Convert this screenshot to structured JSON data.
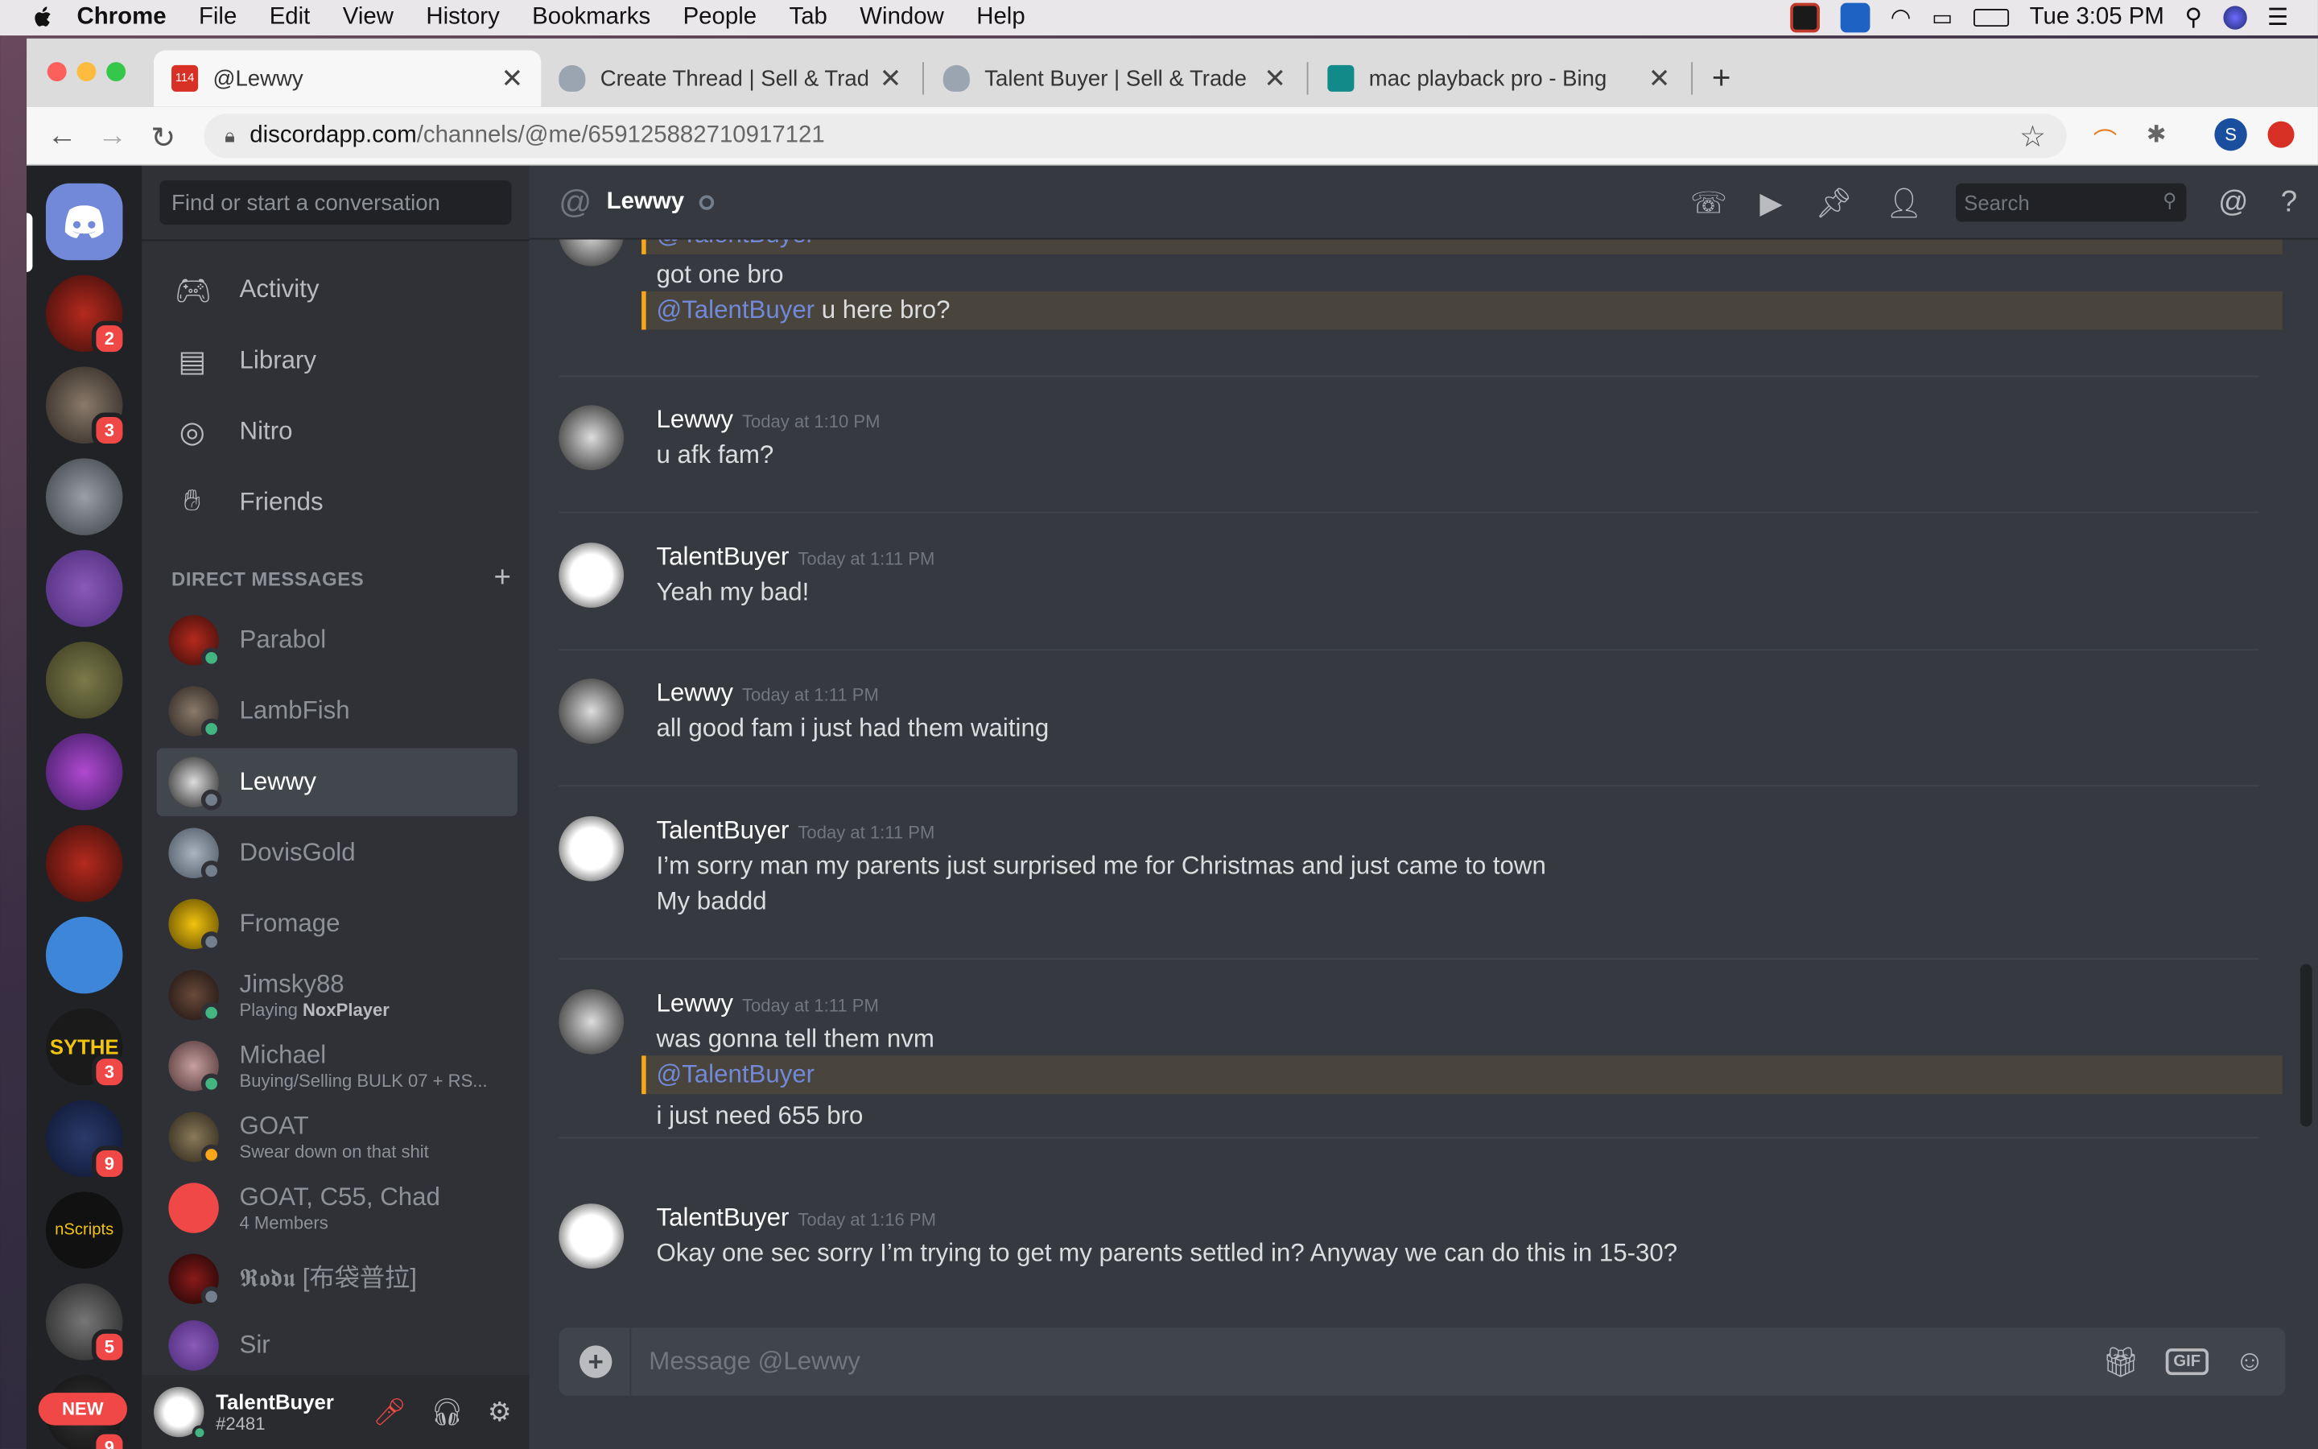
{
  "menubar": {
    "app": "Chrome",
    "items": [
      "File",
      "Edit",
      "View",
      "History",
      "Bookmarks",
      "People",
      "Tab",
      "Window",
      "Help"
    ],
    "clock": "Tue 3:05 PM"
  },
  "browser": {
    "tabs": [
      {
        "title": "@Lewwy",
        "favicon_color": "#d93025",
        "favicon_text": "114"
      },
      {
        "title": "Create Thread | Sell & Trade Ga",
        "favicon_color": "#9aa5b1"
      },
      {
        "title": "Talent Buyer | Sell & Trade Gan",
        "favicon_color": "#9aa5b1"
      },
      {
        "title": "mac playback pro - Bing",
        "favicon_color": "#138a8a"
      }
    ],
    "url_host": "discordapp.com",
    "url_path": "/channels/@me/659125882710917121",
    "profile_letter": "S"
  },
  "discord": {
    "find_placeholder": "Find or start a conversation",
    "nav": [
      "Activity",
      "Library",
      "Nitro",
      "Friends"
    ],
    "dm_header": "DIRECT MESSAGES",
    "guild_badges": [
      "2",
      "3",
      "3",
      "9",
      "9",
      "5"
    ],
    "guild_labels": {
      "sythe": "SYTHE",
      "nscripts": "nScripts",
      "new": "NEW"
    },
    "dms": [
      {
        "name": "Parabol",
        "sub": "",
        "status": "online"
      },
      {
        "name": "LambFish",
        "sub": "",
        "status": "online"
      },
      {
        "name": "Lewwy",
        "sub": "",
        "status": "offline"
      },
      {
        "name": "DovisGold",
        "sub": "",
        "status": "offline"
      },
      {
        "name": "Fromage",
        "sub": "",
        "status": "offline"
      },
      {
        "name": "Jimsky88",
        "sub_prefix": "Playing ",
        "sub_bold": "NoxPlayer",
        "status": "online"
      },
      {
        "name": "Michael",
        "sub": "Buying/Selling BULK 07 + RS...",
        "status": "online"
      },
      {
        "name": "GOAT",
        "sub": "Swear down on that shit",
        "status": "idle"
      },
      {
        "name": "GOAT, C55, Chad",
        "sub": "4 Members",
        "status": ""
      },
      {
        "name": "𝕽𝖔𝖉𝖚 [布袋普拉]",
        "sub": "",
        "status": "offline"
      },
      {
        "name": "Sir",
        "sub": "",
        "status": ""
      }
    ],
    "user": {
      "name": "TalentBuyer",
      "tag": "#2481"
    },
    "channel": {
      "name": "Lewwy",
      "search_placeholder": "Search"
    },
    "messages": {
      "g0": {
        "l1": "@TalentBuyer",
        "l2": "got one bro",
        "l3_mention": "@TalentBuyer",
        "l3_text": " u here bro?"
      },
      "g1": {
        "author": "Lewwy",
        "time": "Today at 1:10 PM",
        "l1": "u afk fam?"
      },
      "g2": {
        "author": "TalentBuyer",
        "time": "Today at 1:11 PM",
        "l1": "Yeah my bad!"
      },
      "g3": {
        "author": "Lewwy",
        "time": "Today at 1:11 PM",
        "l1": "all good fam i just had them waiting"
      },
      "g4": {
        "author": "TalentBuyer",
        "time": "Today at 1:11 PM",
        "l1": "I’m sorry man my parents just surprised me for Christmas and just came to town",
        "l2": "My baddd"
      },
      "g5": {
        "author": "Lewwy",
        "time": "Today at 1:11 PM",
        "l1": "was gonna tell them nvm",
        "l2": "@TalentBuyer",
        "l3": "i just need 655 bro"
      },
      "g6": {
        "author": "TalentBuyer",
        "time": "Today at 1:16 PM",
        "l1": "Okay one sec sorry I’m trying to get my parents settled in? Anyway we can do this in 15-30?"
      }
    },
    "composer_placeholder": "Message @Lewwy",
    "gif_label": "GIF"
  },
  "colors": {
    "blurple": "#7289da",
    "online": "#43b581",
    "idle": "#faa61a",
    "offline": "#747f8d",
    "badge": "#f04747"
  }
}
